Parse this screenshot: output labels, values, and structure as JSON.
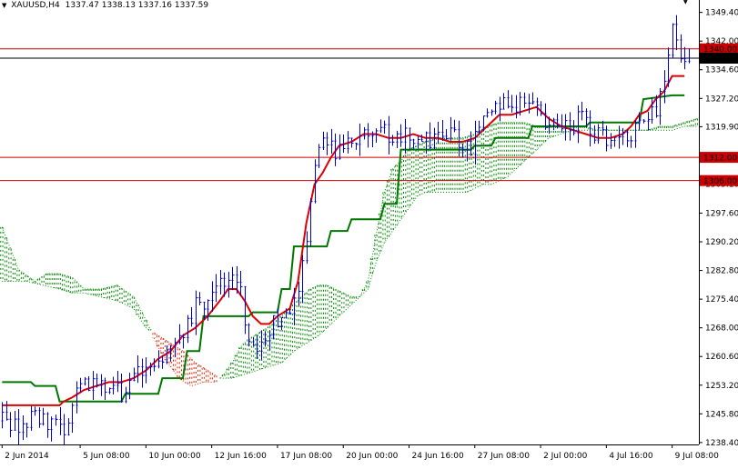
{
  "header": {
    "symbol_timeframe": "XAUUSD,H4",
    "ohlc": "1337.47 1338.13 1337.16 1337.59"
  },
  "chart_data": {
    "type": "candlestick",
    "ylim": [
      1237.9,
      1352.6
    ],
    "x_positions": 170,
    "y_ticks": [
      "1349.40",
      "1342.00",
      "1334.60",
      "1327.20",
      "1319.90",
      "1312.50",
      "1305.10",
      "1297.60",
      "1290.20",
      "1282.80",
      "1275.40",
      "1268.00",
      "1260.60",
      "1253.20",
      "1245.80",
      "1238.40"
    ],
    "x_ticks": [
      {
        "i": 0,
        "label": "2 Jun 2014"
      },
      {
        "i": 19,
        "label": "5 Jun 08:00"
      },
      {
        "i": 35,
        "label": "10 Jun 00:00"
      },
      {
        "i": 51,
        "label": "12 Jun 16:00"
      },
      {
        "i": 67,
        "label": "17 Jun 08:00"
      },
      {
        "i": 83,
        "label": "20 Jun 00:00"
      },
      {
        "i": 99,
        "label": "24 Jun 16:00"
      },
      {
        "i": 115,
        "label": "27 Jun 08:00"
      },
      {
        "i": 131,
        "label": "2 Jul 00:00"
      },
      {
        "i": 147,
        "label": "4 Jul 16:00"
      },
      {
        "i": 163,
        "label": "9 Jul 08:00"
      }
    ],
    "hlines": [
      {
        "name": "resistance-1340",
        "value": 1340.0,
        "label": "1340.00",
        "color": "#cc0000"
      },
      {
        "name": "current-price",
        "value": 1337.59,
        "label": "1337.59",
        "color": "#000000"
      },
      {
        "name": "support-1312",
        "value": 1312.0,
        "label": "1312.00",
        "color": "#cc0000"
      },
      {
        "name": "support-1306",
        "value": 1306.0,
        "label": "1306.00",
        "color": "#cc0000"
      }
    ],
    "anchors": [
      [
        0,
        1244
      ],
      [
        4,
        1243
      ],
      [
        8,
        1245
      ],
      [
        12,
        1244
      ],
      [
        15,
        1242
      ],
      [
        18,
        1251
      ],
      [
        22,
        1254
      ],
      [
        26,
        1253
      ],
      [
        29,
        1251
      ],
      [
        32,
        1255
      ],
      [
        36,
        1260
      ],
      [
        40,
        1262
      ],
      [
        44,
        1266
      ],
      [
        47,
        1274
      ],
      [
        50,
        1276
      ],
      [
        54,
        1280
      ],
      [
        56,
        1283
      ],
      [
        58,
        1277
      ],
      [
        60,
        1265
      ],
      [
        62,
        1262
      ],
      [
        64,
        1266
      ],
      [
        67,
        1270
      ],
      [
        70,
        1273
      ],
      [
        72,
        1278
      ],
      [
        74,
        1292
      ],
      [
        76,
        1312
      ],
      [
        78,
        1318
      ],
      [
        81,
        1314
      ],
      [
        84,
        1316
      ],
      [
        87,
        1317
      ],
      [
        90,
        1320
      ],
      [
        93,
        1319
      ],
      [
        96,
        1316
      ],
      [
        99,
        1318
      ],
      [
        102,
        1316
      ],
      [
        105,
        1316
      ],
      [
        108,
        1318
      ],
      [
        111,
        1316
      ],
      [
        114,
        1314
      ],
      [
        117,
        1321
      ],
      [
        120,
        1327
      ],
      [
        123,
        1326
      ],
      [
        126,
        1325
      ],
      [
        129,
        1327
      ],
      [
        132,
        1322
      ],
      [
        135,
        1321
      ],
      [
        138,
        1320
      ],
      [
        141,
        1322
      ],
      [
        144,
        1318
      ],
      [
        147,
        1317
      ],
      [
        150,
        1316
      ],
      [
        153,
        1318
      ],
      [
        156,
        1321
      ],
      [
        159,
        1325
      ],
      [
        161,
        1330
      ],
      [
        163,
        1344
      ],
      [
        165,
        1339
      ],
      [
        167,
        1337.6
      ]
    ],
    "tenkan_sen": [
      [
        0,
        1248
      ],
      [
        14,
        1248
      ],
      [
        15,
        1249
      ],
      [
        17,
        1250
      ],
      [
        20,
        1252
      ],
      [
        23,
        1253
      ],
      [
        26,
        1254
      ],
      [
        29,
        1254
      ],
      [
        32,
        1255
      ],
      [
        35,
        1257
      ],
      [
        38,
        1260
      ],
      [
        41,
        1262
      ],
      [
        44,
        1266
      ],
      [
        47,
        1268
      ],
      [
        50,
        1271
      ],
      [
        53,
        1275
      ],
      [
        55,
        1278
      ],
      [
        57,
        1278
      ],
      [
        59,
        1275
      ],
      [
        61,
        1271
      ],
      [
        63,
        1269
      ],
      [
        65,
        1269
      ],
      [
        67,
        1271
      ],
      [
        70,
        1273
      ],
      [
        72,
        1280
      ],
      [
        74,
        1295
      ],
      [
        76,
        1305
      ],
      [
        78,
        1308
      ],
      [
        80,
        1312
      ],
      [
        82,
        1315
      ],
      [
        85,
        1316
      ],
      [
        88,
        1318
      ],
      [
        91,
        1318
      ],
      [
        94,
        1317
      ],
      [
        97,
        1317
      ],
      [
        100,
        1318
      ],
      [
        103,
        1317
      ],
      [
        106,
        1317
      ],
      [
        109,
        1316
      ],
      [
        112,
        1316
      ],
      [
        115,
        1317
      ],
      [
        118,
        1320
      ],
      [
        121,
        1323
      ],
      [
        124,
        1323
      ],
      [
        127,
        1324
      ],
      [
        130,
        1325
      ],
      [
        133,
        1322
      ],
      [
        136,
        1320
      ],
      [
        139,
        1319
      ],
      [
        142,
        1318
      ],
      [
        145,
        1317
      ],
      [
        148,
        1317
      ],
      [
        151,
        1318
      ],
      [
        153,
        1320
      ],
      [
        155,
        1323
      ],
      [
        157,
        1324
      ],
      [
        159,
        1327
      ],
      [
        161,
        1329
      ],
      [
        163,
        1333
      ],
      [
        166,
        1333
      ]
    ],
    "kijun_sen": [
      [
        0,
        1254
      ],
      [
        7,
        1254
      ],
      [
        8,
        1253
      ],
      [
        13,
        1253
      ],
      [
        14,
        1249
      ],
      [
        29,
        1249
      ],
      [
        30,
        1251
      ],
      [
        38,
        1251
      ],
      [
        39,
        1255
      ],
      [
        44,
        1255
      ],
      [
        45,
        1262
      ],
      [
        48,
        1262
      ],
      [
        49,
        1271
      ],
      [
        60,
        1271
      ],
      [
        61,
        1272
      ],
      [
        67,
        1272
      ],
      [
        68,
        1278
      ],
      [
        70,
        1278
      ],
      [
        71,
        1289
      ],
      [
        79,
        1289
      ],
      [
        80,
        1293
      ],
      [
        84,
        1293
      ],
      [
        85,
        1296
      ],
      [
        92,
        1296
      ],
      [
        93,
        1300
      ],
      [
        96,
        1300
      ],
      [
        97,
        1314
      ],
      [
        114,
        1314
      ],
      [
        115,
        1315
      ],
      [
        119,
        1315
      ],
      [
        120,
        1317
      ],
      [
        128,
        1317
      ],
      [
        129,
        1320
      ],
      [
        142,
        1320
      ],
      [
        143,
        1321
      ],
      [
        155,
        1321
      ],
      [
        156,
        1327
      ],
      [
        163,
        1328
      ],
      [
        166,
        1328
      ]
    ],
    "span_a": [
      [
        0,
        1294
      ],
      [
        4,
        1283
      ],
      [
        8,
        1280
      ],
      [
        11,
        1282
      ],
      [
        14,
        1282
      ],
      [
        17,
        1281
      ],
      [
        20,
        1278
      ],
      [
        24,
        1278
      ],
      [
        28,
        1279
      ],
      [
        32,
        1276
      ],
      [
        35,
        1270
      ],
      [
        38,
        1263
      ],
      [
        41,
        1258
      ],
      [
        43,
        1255
      ],
      [
        46,
        1253
      ],
      [
        49,
        1254
      ],
      [
        52,
        1254
      ],
      [
        54,
        1256
      ],
      [
        56,
        1259
      ],
      [
        58,
        1263
      ],
      [
        60,
        1265
      ],
      [
        63,
        1267
      ],
      [
        66,
        1269
      ],
      [
        69,
        1272
      ],
      [
        71,
        1274
      ],
      [
        73,
        1276
      ],
      [
        75,
        1278
      ],
      [
        77,
        1279
      ],
      [
        79,
        1279
      ],
      [
        81,
        1278
      ],
      [
        83,
        1277
      ],
      [
        85,
        1276
      ],
      [
        87,
        1276
      ],
      [
        89,
        1280
      ],
      [
        91,
        1292
      ],
      [
        93,
        1303
      ],
      [
        95,
        1309
      ],
      [
        97,
        1311
      ],
      [
        99,
        1314
      ],
      [
        101,
        1315
      ],
      [
        103,
        1316
      ],
      [
        106,
        1317
      ],
      [
        109,
        1317
      ],
      [
        112,
        1317
      ],
      [
        115,
        1318
      ],
      [
        118,
        1320
      ],
      [
        121,
        1321
      ],
      [
        124,
        1321
      ],
      [
        127,
        1321
      ],
      [
        130,
        1320
      ],
      [
        133,
        1320
      ],
      [
        136,
        1320
      ],
      [
        139,
        1320
      ],
      [
        142,
        1320
      ],
      [
        145,
        1319
      ],
      [
        148,
        1319
      ],
      [
        151,
        1319
      ],
      [
        154,
        1319
      ],
      [
        157,
        1319
      ],
      [
        160,
        1320
      ],
      [
        163,
        1320
      ],
      [
        166,
        1321
      ],
      [
        169,
        1322
      ]
    ],
    "span_b": [
      [
        0,
        1280
      ],
      [
        6,
        1280
      ],
      [
        10,
        1279
      ],
      [
        14,
        1278
      ],
      [
        17,
        1277
      ],
      [
        20,
        1277
      ],
      [
        24,
        1276
      ],
      [
        28,
        1275
      ],
      [
        32,
        1273
      ],
      [
        35,
        1268
      ],
      [
        38,
        1266
      ],
      [
        41,
        1264
      ],
      [
        44,
        1262
      ],
      [
        47,
        1259
      ],
      [
        50,
        1257
      ],
      [
        53,
        1255
      ],
      [
        56,
        1255
      ],
      [
        59,
        1256
      ],
      [
        62,
        1257
      ],
      [
        65,
        1258
      ],
      [
        68,
        1259
      ],
      [
        71,
        1262
      ],
      [
        74,
        1264
      ],
      [
        77,
        1266
      ],
      [
        79,
        1268
      ],
      [
        81,
        1270
      ],
      [
        83,
        1272
      ],
      [
        85,
        1274
      ],
      [
        87,
        1276
      ],
      [
        89,
        1278
      ],
      [
        91,
        1285
      ],
      [
        93,
        1290
      ],
      [
        95,
        1293
      ],
      [
        97,
        1296
      ],
      [
        99,
        1299
      ],
      [
        101,
        1302
      ],
      [
        103,
        1303
      ],
      [
        105,
        1303
      ],
      [
        107,
        1303
      ],
      [
        109,
        1303
      ],
      [
        111,
        1303
      ],
      [
        113,
        1303
      ],
      [
        115,
        1304
      ],
      [
        117,
        1305
      ],
      [
        119,
        1305
      ],
      [
        121,
        1306
      ],
      [
        123,
        1307
      ],
      [
        125,
        1309
      ],
      [
        127,
        1311
      ],
      [
        129,
        1313
      ],
      [
        131,
        1315
      ],
      [
        133,
        1317
      ],
      [
        136,
        1318
      ],
      [
        139,
        1319
      ],
      [
        142,
        1319
      ],
      [
        145,
        1319
      ],
      [
        148,
        1319
      ],
      [
        151,
        1319
      ],
      [
        154,
        1319
      ],
      [
        157,
        1319
      ],
      [
        160,
        1319
      ],
      [
        163,
        1319
      ],
      [
        166,
        1320
      ],
      [
        169,
        1320
      ]
    ]
  },
  "colors": {
    "background": "#ffffff",
    "candle": "#0000cc",
    "tenkan": "#dd0000",
    "kijun": "#007700",
    "cloud_bull": "#008800",
    "cloud_bear": "#dd2200",
    "level_line": "#cc0000",
    "level_label_bg": "#cc0000",
    "price_label_bg": "#000000"
  }
}
